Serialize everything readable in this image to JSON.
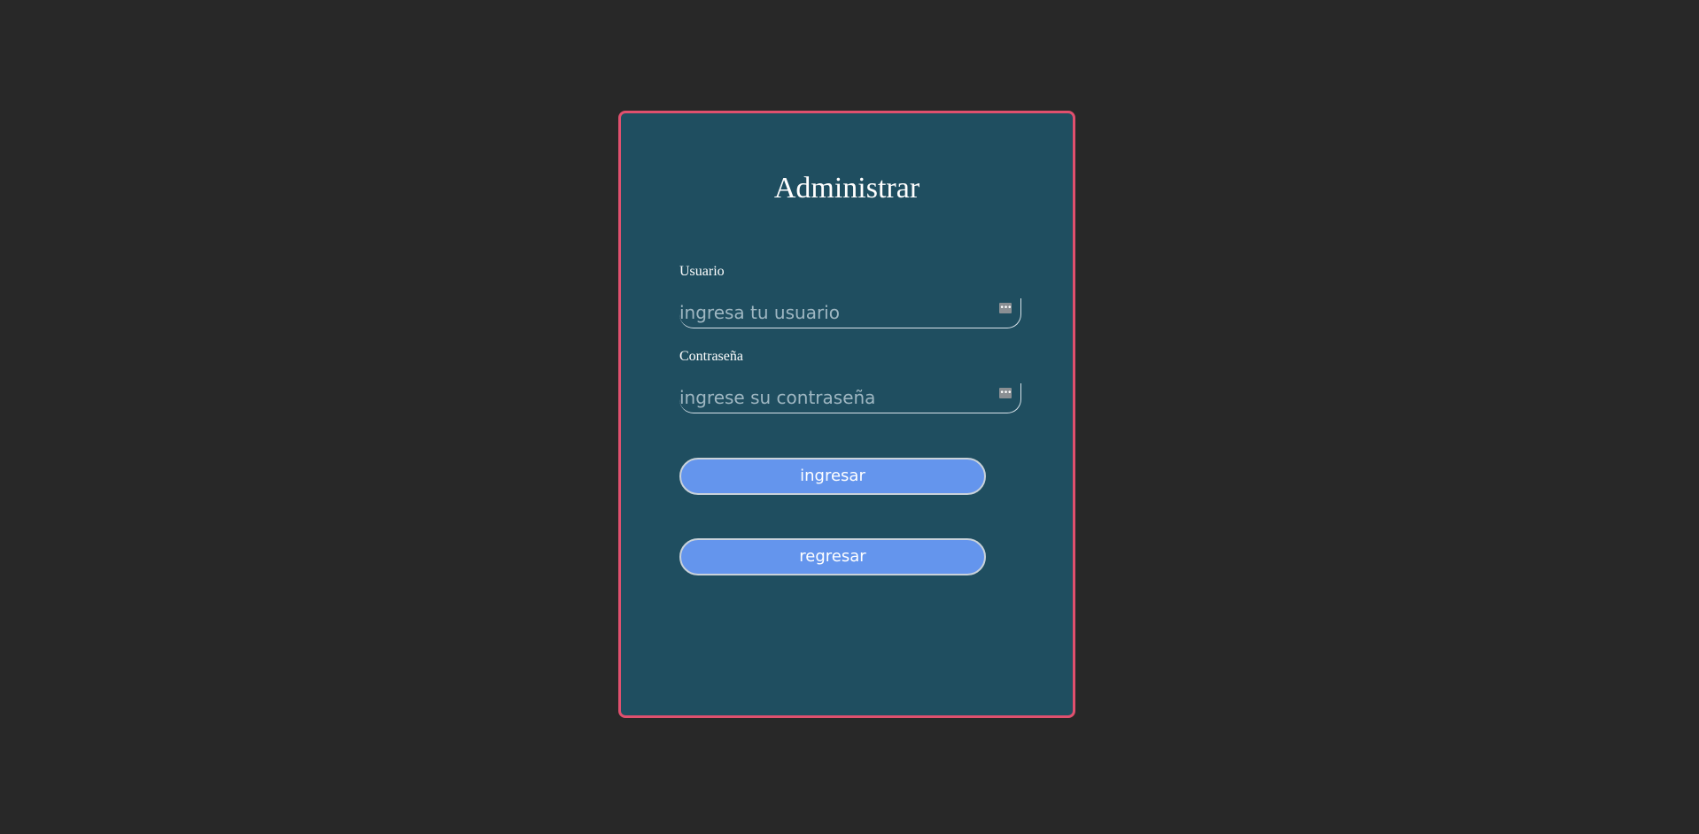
{
  "form": {
    "title": "Administrar",
    "username": {
      "label": "Usuario",
      "value": "",
      "placeholder": "ingresa tu usuario",
      "icon": "password-manager-icon"
    },
    "password": {
      "label": "Contraseña",
      "value": "",
      "placeholder": "ingrese su contraseña",
      "icon": "password-manager-icon"
    },
    "login_button_label": "ingresar",
    "back_button_label": "regresar"
  },
  "colors": {
    "page_background": "#282828",
    "card_background": "#1f4e60",
    "card_border": "#e0506e",
    "button_background": "#6495ed",
    "text": "#ffffff"
  }
}
